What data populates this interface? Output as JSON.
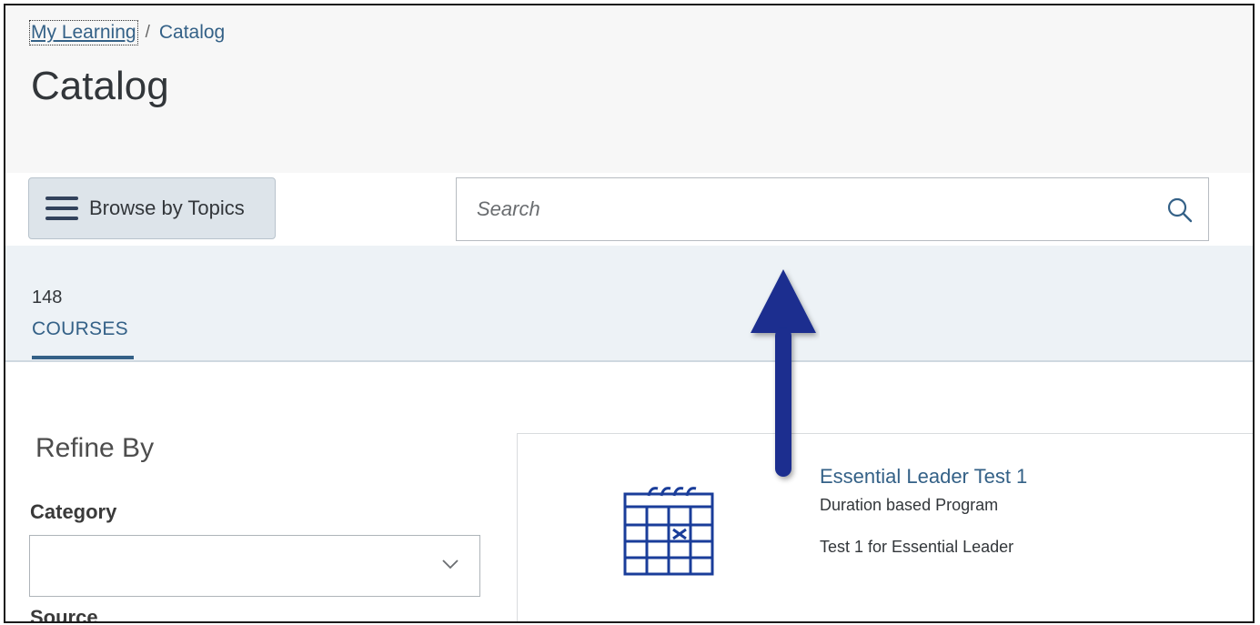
{
  "breadcrumb": {
    "link": "My Learning",
    "separator": "/",
    "current": "Catalog"
  },
  "page_title": "Catalog",
  "toolbar": {
    "browse_label": "Browse by Topics",
    "search_placeholder": "Search"
  },
  "tabs": [
    {
      "count": "148",
      "label": "COURSES",
      "selected": true
    }
  ],
  "refine": {
    "title": "Refine By",
    "category_label": "Category",
    "category_value": "",
    "source_label": "Source"
  },
  "courses": [
    {
      "title": "Essential Leader Test 1",
      "type": "Duration based Program",
      "description": "Test 1 for Essential Leader",
      "icon": "calendar-icon"
    }
  ],
  "colors": {
    "accent": "#346187",
    "arrow": "#1a2f8f"
  }
}
